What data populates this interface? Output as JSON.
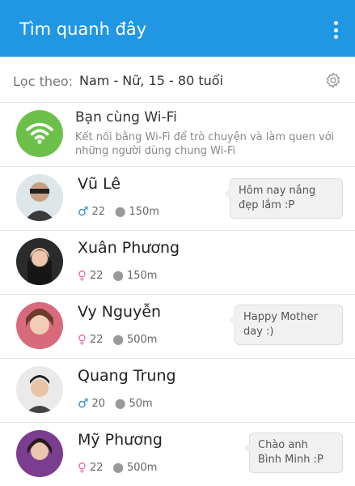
{
  "app": {
    "title": "Tìm quanh đây",
    "menu_icon": "more-vert-icon"
  },
  "filter": {
    "label": "Lọc theo:",
    "value": "Nam - Nữ, 15 - 80 tuổi",
    "settings_icon": "gear-icon"
  },
  "wifi": {
    "title": "Bạn cùng Wi-Fi",
    "description": "Kết nối bằng Wi-Fi để trò chuyện và làm quen với những người dùng chung Wi-Fi",
    "icon": "wifi-icon",
    "color": "#6cc04a"
  },
  "people": [
    {
      "name": "Vũ Lê",
      "gender": "male",
      "gender_symbol": "♂",
      "age": "22",
      "distance": "150m",
      "status": "Hôm nay nắng đẹp lắm :P"
    },
    {
      "name": "Xuân Phương",
      "gender": "female",
      "gender_symbol": "♀",
      "age": "22",
      "distance": "150m",
      "status": ""
    },
    {
      "name": "Vy Nguyễn",
      "gender": "female",
      "gender_symbol": "♀",
      "age": "22",
      "distance": "500m",
      "status": "Happy Mother day :)"
    },
    {
      "name": "Quang Trung",
      "gender": "male",
      "gender_symbol": "♂",
      "age": "20",
      "distance": "50m",
      "status": ""
    },
    {
      "name": "Mỹ Phương",
      "gender": "female",
      "gender_symbol": "♀",
      "age": "22",
      "distance": "500m",
      "status": "Chào anh Bình Minh :P"
    }
  ],
  "colors": {
    "appbar": "#2196e3",
    "male": "#2a8ad6",
    "female": "#ec6aa6"
  }
}
